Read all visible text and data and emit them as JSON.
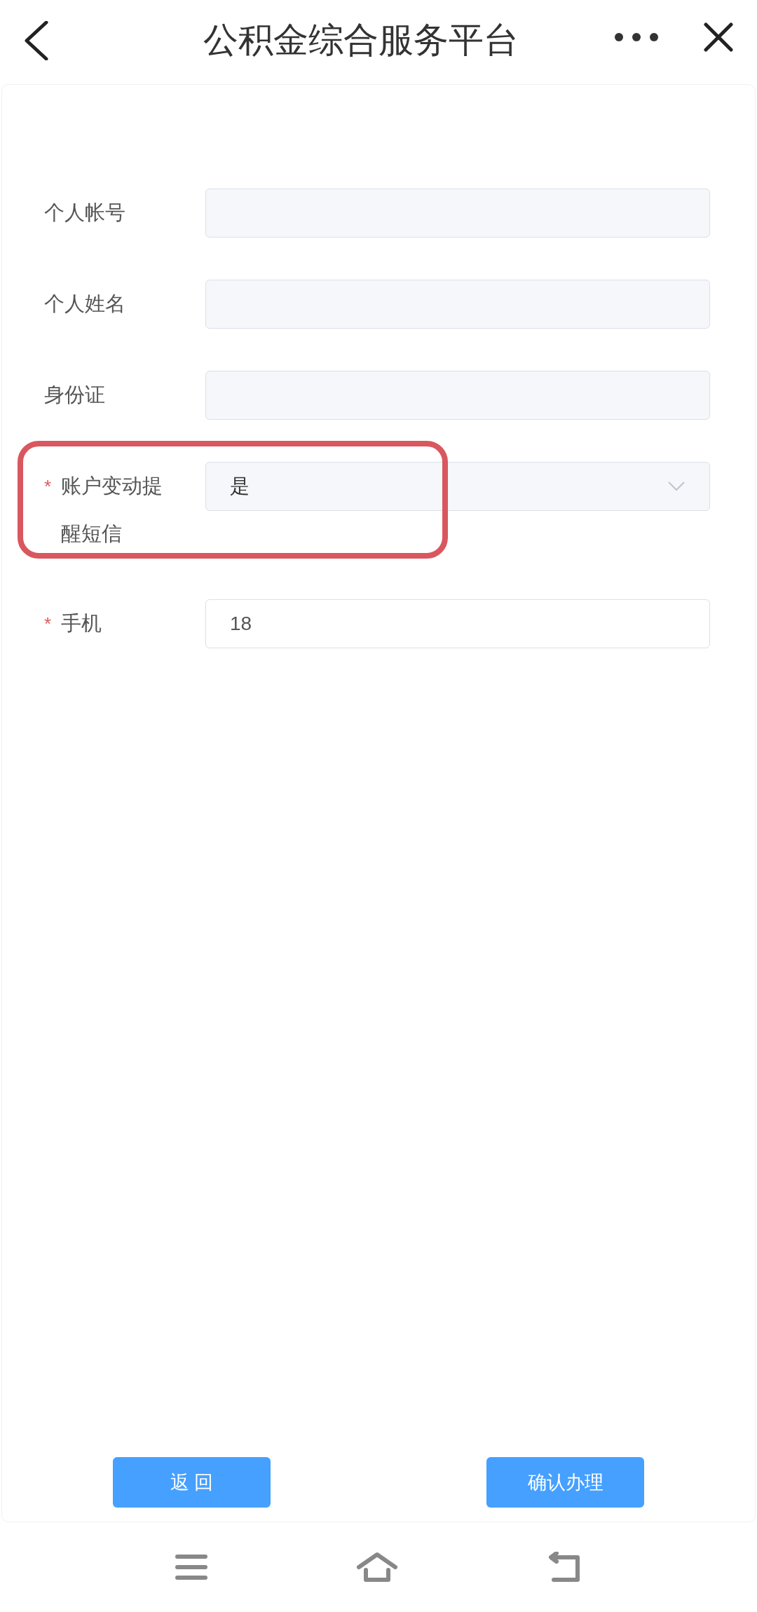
{
  "header": {
    "title": "公积金综合服务平台"
  },
  "form": [
    {
      "label": "个人帐号",
      "kind": "text"
    },
    {
      "label": "个人姓名",
      "kind": "text"
    },
    {
      "label": "身份证",
      "kind": "text"
    },
    {
      "label": "账户变动提醒短信",
      "required_mark": "*",
      "kind": "select",
      "value": "是",
      "highlighted": true
    },
    {
      "label": "手机",
      "required_mark": "*",
      "kind": "text",
      "value": "18"
    }
  ],
  "buttons": [
    "返 回",
    "确认办理"
  ]
}
